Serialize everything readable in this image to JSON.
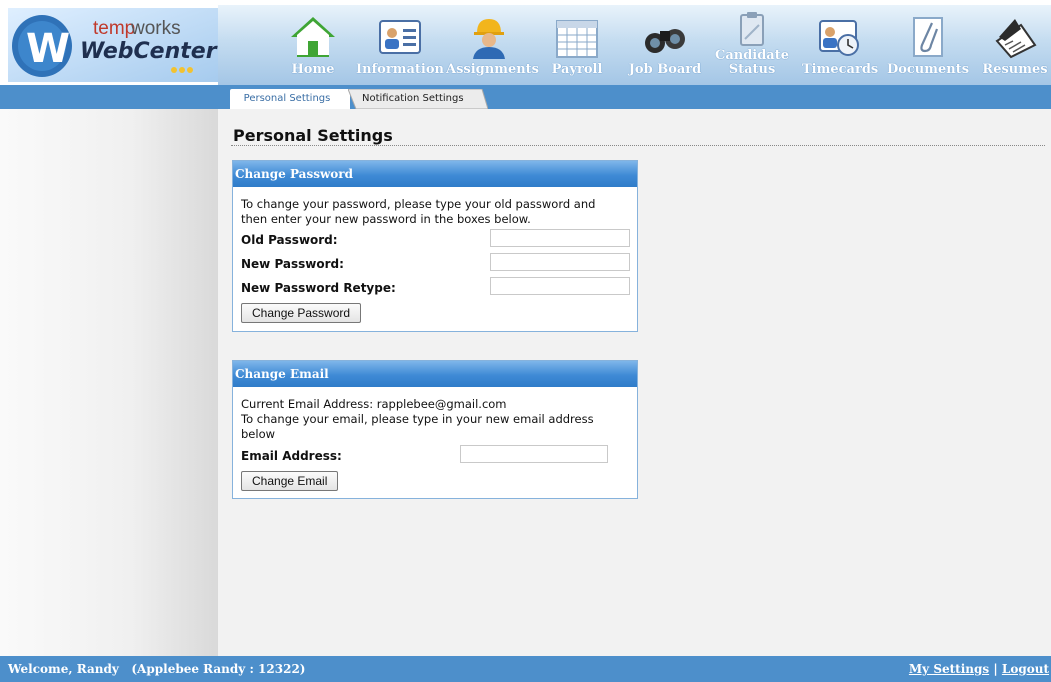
{
  "logo": {
    "word1": "temp",
    "word2": "works",
    "word3": "WebCenter",
    "letter": "W"
  },
  "nav": [
    {
      "label": "Home",
      "icon": "home-icon"
    },
    {
      "label": "Information",
      "icon": "id-card-icon"
    },
    {
      "label": "Assignments",
      "icon": "worker-icon"
    },
    {
      "label": "Payroll",
      "icon": "calendar-icon"
    },
    {
      "label": "Job Board",
      "icon": "binoculars-icon"
    },
    {
      "label": "Candidate Status",
      "label_line1": "Candidate",
      "label_line2": "Status",
      "icon": "clipboard-icon"
    },
    {
      "label": "Timecards",
      "icon": "timecard-icon"
    },
    {
      "label": "Documents",
      "icon": "paperclip-icon"
    },
    {
      "label": "Resumes",
      "icon": "resume-icon"
    }
  ],
  "tabs": {
    "personal": "Personal Settings",
    "notification": "Notification Settings"
  },
  "page": {
    "title": "Personal Settings"
  },
  "password": {
    "heading": "Change Password",
    "instructions": "To change your password, please type your old password and then enter your new password in the boxes below.",
    "old_label": "Old Password:",
    "new_label": "New Password:",
    "retype_label": "New Password Retype:",
    "old_value": "",
    "new_value": "",
    "retype_value": "",
    "button": "Change Password"
  },
  "email": {
    "heading": "Change Email",
    "current_label": "Current Email Address:",
    "current_value": "rapplebee@gmail.com",
    "instructions": "To change your email, please type in your new email address below",
    "field_label": "Email Address:",
    "field_value": "",
    "button": "Change Email"
  },
  "footer": {
    "welcome": "Welcome, Randy",
    "account": "(Applebee Randy : 12322)",
    "my_settings": "My Settings",
    "separator": "|",
    "logout": "Logout"
  },
  "colors": {
    "band": "#4d8fcb",
    "panel_head": "#3f8ad5",
    "nav_gradient_bottom": "#a4c6e6"
  }
}
